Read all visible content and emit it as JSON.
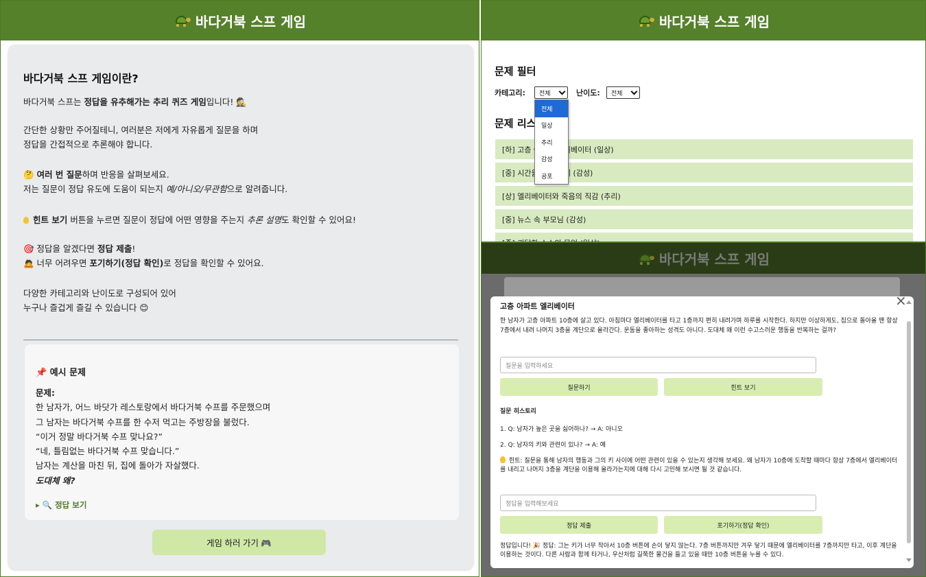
{
  "app": {
    "title": "바다거북 스프 게임"
  },
  "intro": {
    "heading": "바다거북 스프 게임이란?",
    "p1_a": "바다거북 스프는 ",
    "p1_b": "정답을 유추해가는 추리 퀴즈 게임",
    "p1_c": "입니다! 🕵️",
    "p2_a": "간단한 상황만 주어질테니, 여러분은 저에게 자유롭게 질문을 하며",
    "p2_b": "정답을 간접적으로 추론해야 합니다.",
    "p3_icon": "🤔",
    "p3_bold": "여러 번 질문",
    "p3_rest": "하며 반응을 살펴보세요.",
    "p3_b_a": "저는 질문이 정답 유도에 도움이 되는지 ",
    "p3_b_em": "예/아니오/무관함",
    "p3_b_c": "으로 알려줍니다.",
    "p4_bold": "힌트 보기",
    "p4_a": " 버튼을 누르면 질문이 정답에 어떤 영향을 주는지 ",
    "p4_em": "추론 설명",
    "p4_c": "도 확인할 수 있어요!",
    "p5_icon": "🎯",
    "p5_a": " 정답을 알겠다면 ",
    "p5_bold": "정답 제출",
    "p5_c": "!",
    "p6_icon": "🙇",
    "p6_a": " 너무 어려우면 ",
    "p6_bold": "포기하기(정답 확인)",
    "p6_c": "로 정답을 확인할 수 있어요.",
    "p7_a": "다양한 카테고리와 난이도로 구성되어 있어",
    "p7_b": "누구나 즐겁게 즐길 수 있습니다 😊"
  },
  "example": {
    "heading": "예시 문제",
    "label": "문제:",
    "lines": [
      "한 남자가, 어느 바닷가 레스토랑에서 바다거북 수프를 주문했으며",
      "그 남자는 바다거북 수프를 한 수저 먹고는 주방장을 불렀다.",
      "“이거 정말 바다거북 수프 맞나요?”",
      "“네, 틀림없는 바다거북 수프 맞습니다.”",
      "남자는 계산을 마친 뒤, 집에 돌아가 자살했다."
    ],
    "last": "도대체 왜?",
    "reveal": "🔍 정답 보기"
  },
  "play_button": "게임 하러 가기 🎮",
  "filter": {
    "heading": "문제 필터",
    "category_label": "카테고리:",
    "category_value": "전체",
    "difficulty_label": "난이도:",
    "difficulty_value": "전체",
    "options": [
      "전체",
      "일상",
      "추리",
      "감성",
      "공포"
    ]
  },
  "problem_list": {
    "heading": "문제 리스트",
    "items": [
      "[하] 고층 아파트 엘리베이터 (일상)",
      "[중] 시간을 멈춘 시계 (감성)",
      "[상] 엘리베이터와 죽음의 직감 (추리)",
      "[중] 뉴스 속 부모님 (감성)",
      "[중] 괴담한 소스의 무엇 (일상)"
    ]
  },
  "modal": {
    "title": "고층 아파트 엘리베이터",
    "story": "한 남자가 고층 아파트 10층에 살고 있다. 아침마다 엘리베이터를 타고 1층까지 편히 내려가며 하루를 시작한다. 하지만 이상하게도, 집으로 돌아올 땐 항상 7층에서 내려 나머지 3층을 계단으로 올라간다. 운동을 좋아하는 성격도 아니다. 도대체 왜 이런 수고스러운 행동을 반복하는 걸까?",
    "question_placeholder": "질문을 입력하세요",
    "ask_button": "질문하기",
    "hint_button": "힌트 보기",
    "history_heading": "질문 히스토리",
    "history": [
      "1. Q: 남자가 높은 곳을 싫어하나? → A: 아니오",
      "2. Q: 남자의 키와 관련이 있나? → A: 예"
    ],
    "hint": "힌트: 질문을 통해 남자의 행동과 그의 키 사이에 어떤 관련이 있을 수 있는지 생각해 보세요. 왜 남자가 10층에 도착할 때마다 항상 7층에서 엘리베이터를 내리고 나머지 3층을 계단을 이용해 올라가는지에 대해 다시 고민해 보시면 될 것 같습니다.",
    "answer_placeholder": "정답을 입력해보세요",
    "submit_button": "정답 제출",
    "giveup_button": "포기하기(정답 확인)",
    "answer": "정답입니다! 🎉 정답: 그는 키가 너무 작아서 10층 버튼에 손이 닿지 않는다. 7층 버튼까지만 겨우 닿기 때문에 엘리베이터를 7층까지만 타고, 이후 계단을 이용하는 것이다. 다른 사람과 함께 타거나, 우산처럼 길쭉한 물건을 들고 있을 때만 10층 버튼을 누를 수 있다."
  },
  "colors": {
    "header": "#55812a",
    "button": "#cfe8a6",
    "list_item": "#d8eac0",
    "accent": "#4d7a24"
  }
}
